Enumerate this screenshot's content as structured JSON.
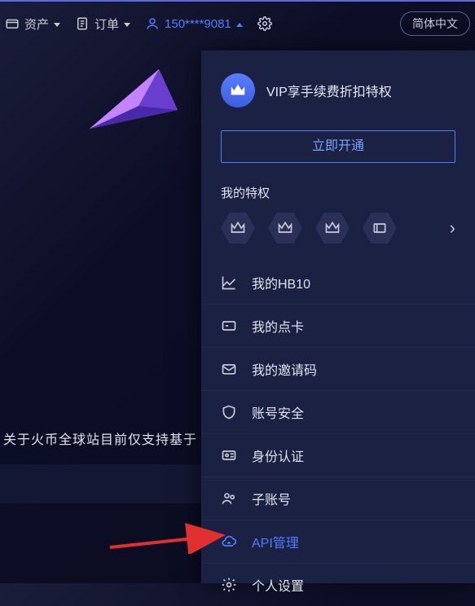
{
  "nav": {
    "assets_label": "资产",
    "orders_label": "订单",
    "account_label": "150****9081",
    "lang_label": "简体中文"
  },
  "panel": {
    "vip_text": "VIP享手续费折扣特权",
    "activate_label": "立即开通",
    "privileges_title": "我的特权"
  },
  "menu": {
    "hb10": "我的HB10",
    "card": "我的点卡",
    "invite": "我的邀请码",
    "security": "账号安全",
    "identity": "身份认证",
    "subaccount": "子账号",
    "api": "API管理",
    "personal": "个人设置"
  },
  "notice": "关于火币全球站目前仅支持基于"
}
